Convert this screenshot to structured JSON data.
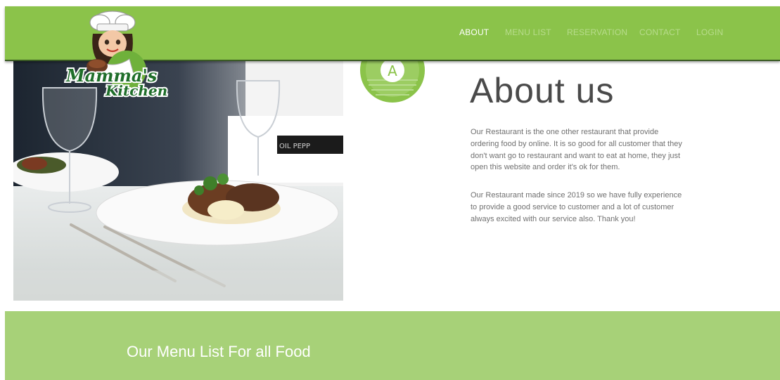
{
  "brand": {
    "logo_line1": "Mamma's",
    "logo_line2": "Kitchen"
  },
  "nav": {
    "items": [
      {
        "label": "ABOUT",
        "active": true
      },
      {
        "label": "MENU LIST",
        "active": false
      },
      {
        "label": "RESERVATION",
        "active": false
      },
      {
        "label": "CONTACT",
        "active": false
      },
      {
        "label": "LOGIN",
        "active": false
      }
    ]
  },
  "about": {
    "badge_letter": "A",
    "title": "About us",
    "paragraph1": "Our Restaurant is the one other restaurant that provide ordering food by online. It is so good for all customer that they don't want go to restaurant and want to eat at home, they just open this website and order it's ok for them.",
    "paragraph2": "Our Restaurant made since 2019 so we have fully experience to provide a good service to customer and a lot of customer always excited with our service also. Thank you!",
    "photo_bottle_text": "OIL   PEPP"
  },
  "menu_section": {
    "heading": "Our Menu List For all Food"
  },
  "colors": {
    "nav_bg": "#8bc34a",
    "nav_link": "#b8dc8c",
    "nav_active": "#ffffff",
    "menu_band": "#a7d178",
    "title_text": "#4a4a4a",
    "body_text": "#707070"
  }
}
